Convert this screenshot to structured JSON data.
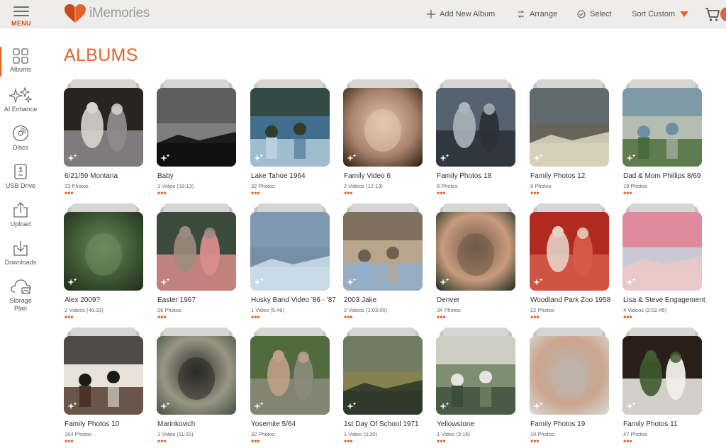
{
  "header": {
    "menu_label": "MENU",
    "logo_text": "iMemories",
    "add_album": "Add New Album",
    "arrange": "Arrange",
    "select": "Select",
    "sort": "Sort Custom"
  },
  "sidebar": {
    "items": [
      {
        "label": "Albums",
        "icon": "albums-grid-icon"
      },
      {
        "label": "AI Enhance",
        "icon": "sparkles-icon"
      },
      {
        "label": "Discs",
        "icon": "disc-icon"
      },
      {
        "label": "USB Drive",
        "icon": "usb-drive-icon"
      },
      {
        "label": "Upload",
        "icon": "upload-icon"
      },
      {
        "label": "Downloads",
        "icon": "download-icon"
      },
      {
        "label": "Storage",
        "label2": "Plan",
        "icon": "cloud-storage-icon"
      }
    ]
  },
  "page": {
    "title": "ALBUMS"
  },
  "colors": {
    "accent": "#e2642c",
    "topbar": "#efedeb"
  },
  "albums": [
    {
      "title": "6/21/59 Montana",
      "count": "23 Photos",
      "colors": [
        "#2a2420",
        "#8e8a8c",
        "#d9d4cf"
      ]
    },
    {
      "title": "Baby",
      "count": "1 Video (16:13)",
      "colors": [
        "#111111",
        "#7f7f7f",
        "#c8c8c8"
      ]
    },
    {
      "title": "Lake Tahoe 1964",
      "count": "32 Photos",
      "colors": [
        "#b8d0e0",
        "#416e8e",
        "#2f3d2a"
      ]
    },
    {
      "title": "Family Video 6",
      "count": "2 Videos (12:13)",
      "colors": [
        "#3a2a1c",
        "#a7826a",
        "#e2c9ad"
      ]
    },
    {
      "title": "Family Photos 18",
      "count": "8 Photos",
      "colors": [
        "#556270",
        "#2b3036",
        "#a9b4bb"
      ]
    },
    {
      "title": "Family Photos 12",
      "count": "9 Photos",
      "colors": [
        "#d6d0b8",
        "#2f3f4f",
        "#1c1c1c"
      ]
    },
    {
      "title": "Dad & Mom Phillips 8/69",
      "count": "19 Photos",
      "colors": [
        "#4a6b3a",
        "#b5bdb0",
        "#6b8fa3"
      ]
    },
    {
      "title": "Alex 2009?",
      "count": "2 Videos (46:33)",
      "colors": [
        "#23331f",
        "#3c5533",
        "#6e8a60"
      ]
    },
    {
      "title": "Easter 1967",
      "count": "26 Photos",
      "colors": [
        "#3b4a3a",
        "#d98b8b",
        "#9c8c80"
      ]
    },
    {
      "title": "Husky Band Video '86 - '87",
      "count": "1 Video (5:46)",
      "colors": [
        "#c9d9e8",
        "#5f7ea0",
        "#3f5d7f"
      ]
    },
    {
      "title": "2003 Jake",
      "count": "2 Videos (1:03:00)",
      "colors": [
        "#8fb0cf",
        "#b9a58c",
        "#6e6050"
      ]
    },
    {
      "title": "Denver",
      "count": "34 Photos",
      "colors": [
        "#2f3b2a",
        "#c89b7d",
        "#6f5a48"
      ]
    },
    {
      "title": "Woodland Park Zoo 1958",
      "count": "22 Photos",
      "colors": [
        "#b02a1f",
        "#d65a4a",
        "#e6d0c4"
      ]
    },
    {
      "title": "Lisa & Steve Engagement",
      "count": "4 Videos (2:02:45)",
      "colors": [
        "#e9c8c8",
        "#d9728a",
        "#b7c8e0"
      ]
    },
    {
      "title": "Family Photos 10",
      "count": "164 Photos",
      "colors": [
        "#4a3224",
        "#e8e2da",
        "#1a1a1a"
      ]
    },
    {
      "title": "Marinkovich",
      "count": "1 Video (11:31)",
      "colors": [
        "#4f5a4a",
        "#9a9684",
        "#2a2a26"
      ]
    },
    {
      "title": "Yosemite 5/64",
      "count": "32 Photos",
      "colors": [
        "#516b3d",
        "#8a8a7a",
        "#bfa08a"
      ]
    },
    {
      "title": "1st Day Of School 1971",
      "count": "1 Video (3:20)",
      "colors": [
        "#2f3a2a",
        "#8c9a7c",
        "#c0b26a"
      ]
    },
    {
      "title": "Yellowstone",
      "count": "1 Video (3:15)",
      "colors": [
        "#3b4e3a",
        "#7d8f70",
        "#e8e4e0"
      ]
    },
    {
      "title": "Family Photos 19",
      "count": "10 Photos",
      "colors": [
        "#d8d4cf",
        "#caa68e",
        "#bdb5ad"
      ]
    },
    {
      "title": "Family Photos 11",
      "count": "47 Photos",
      "colors": [
        "#2a1e18",
        "#f1eeea",
        "#3e5a2f"
      ]
    }
  ]
}
